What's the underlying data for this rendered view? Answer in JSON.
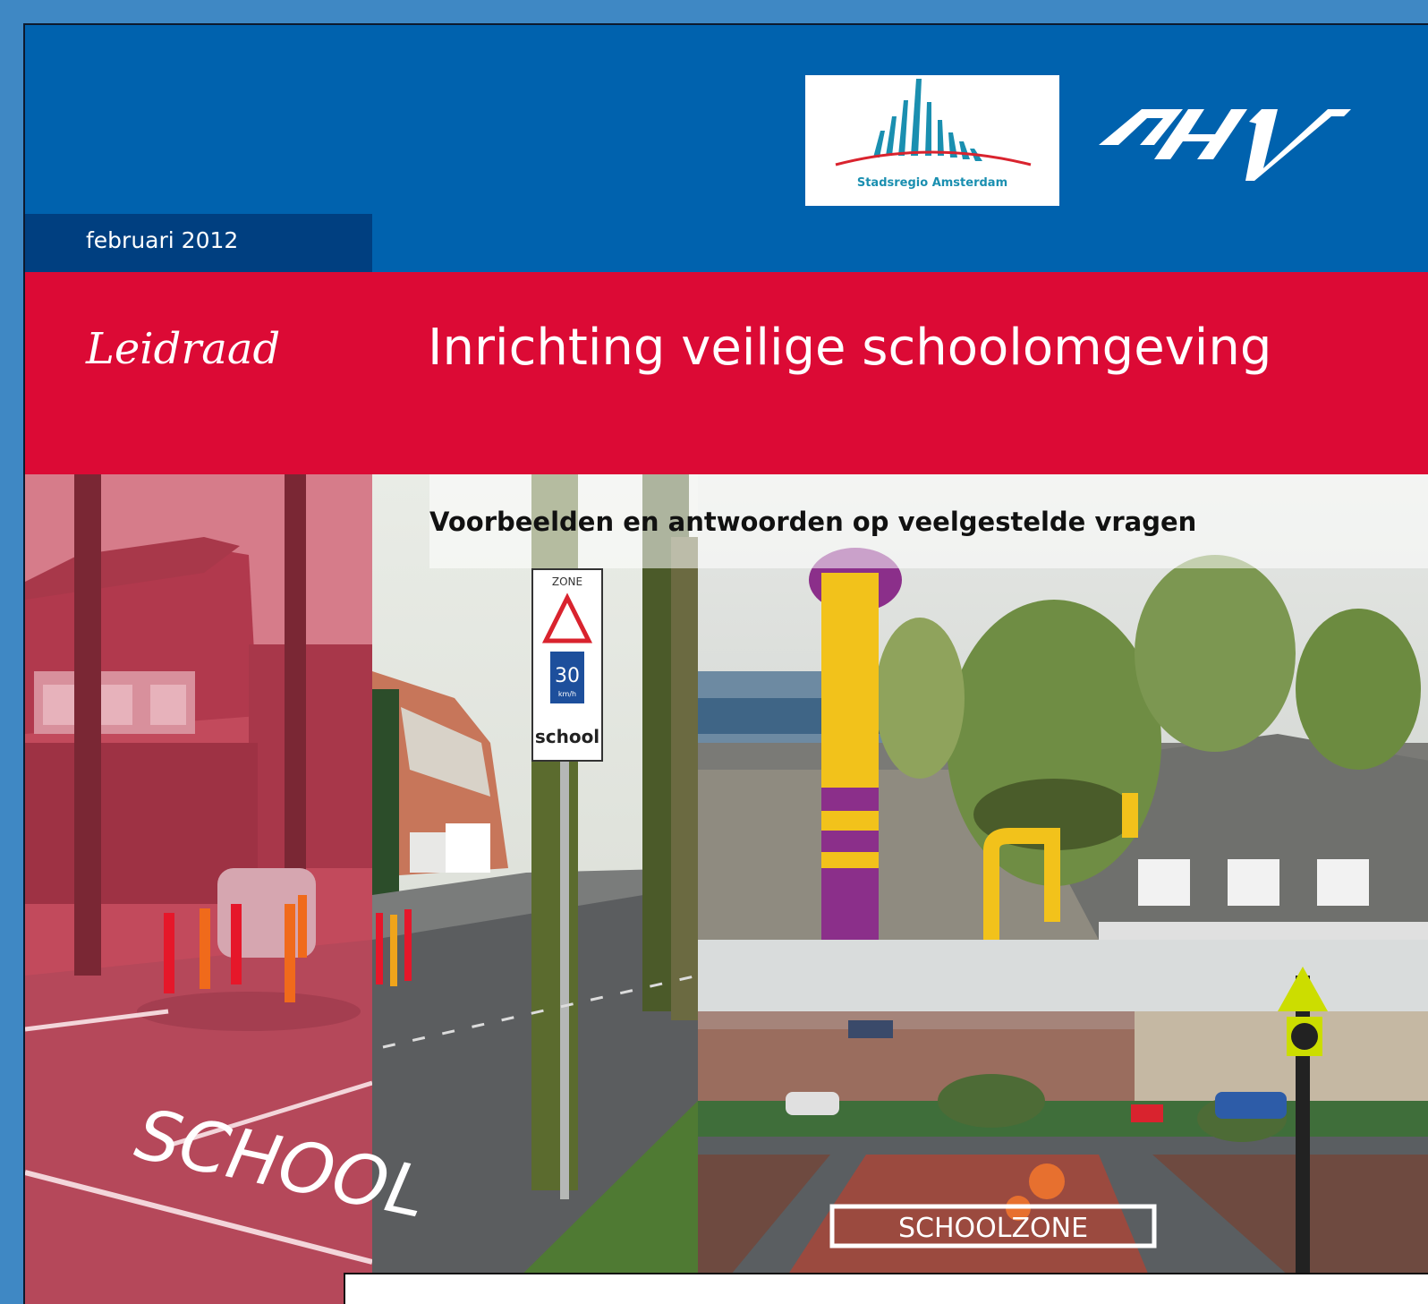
{
  "header": {
    "brand_color": "#0062ae",
    "logo_stadsregio_text": "Stadsregio Amsterdam",
    "logo_dhv_text": "DHV"
  },
  "date": "februari 2012",
  "band": {
    "color": "#dc0a35",
    "kicker": "Leidraad",
    "title": "Inrichting veilige schoolomgeving"
  },
  "subtitle": "Voorbeelden en antwoorden op veelgestelde vragen",
  "photos": {
    "sign_zone": "ZONE",
    "sign_speed": "30",
    "sign_unit": "km/h",
    "sign_school": "school",
    "road_school": "SCHOOL",
    "road_schoolzone": "SCHOOLZONE"
  }
}
